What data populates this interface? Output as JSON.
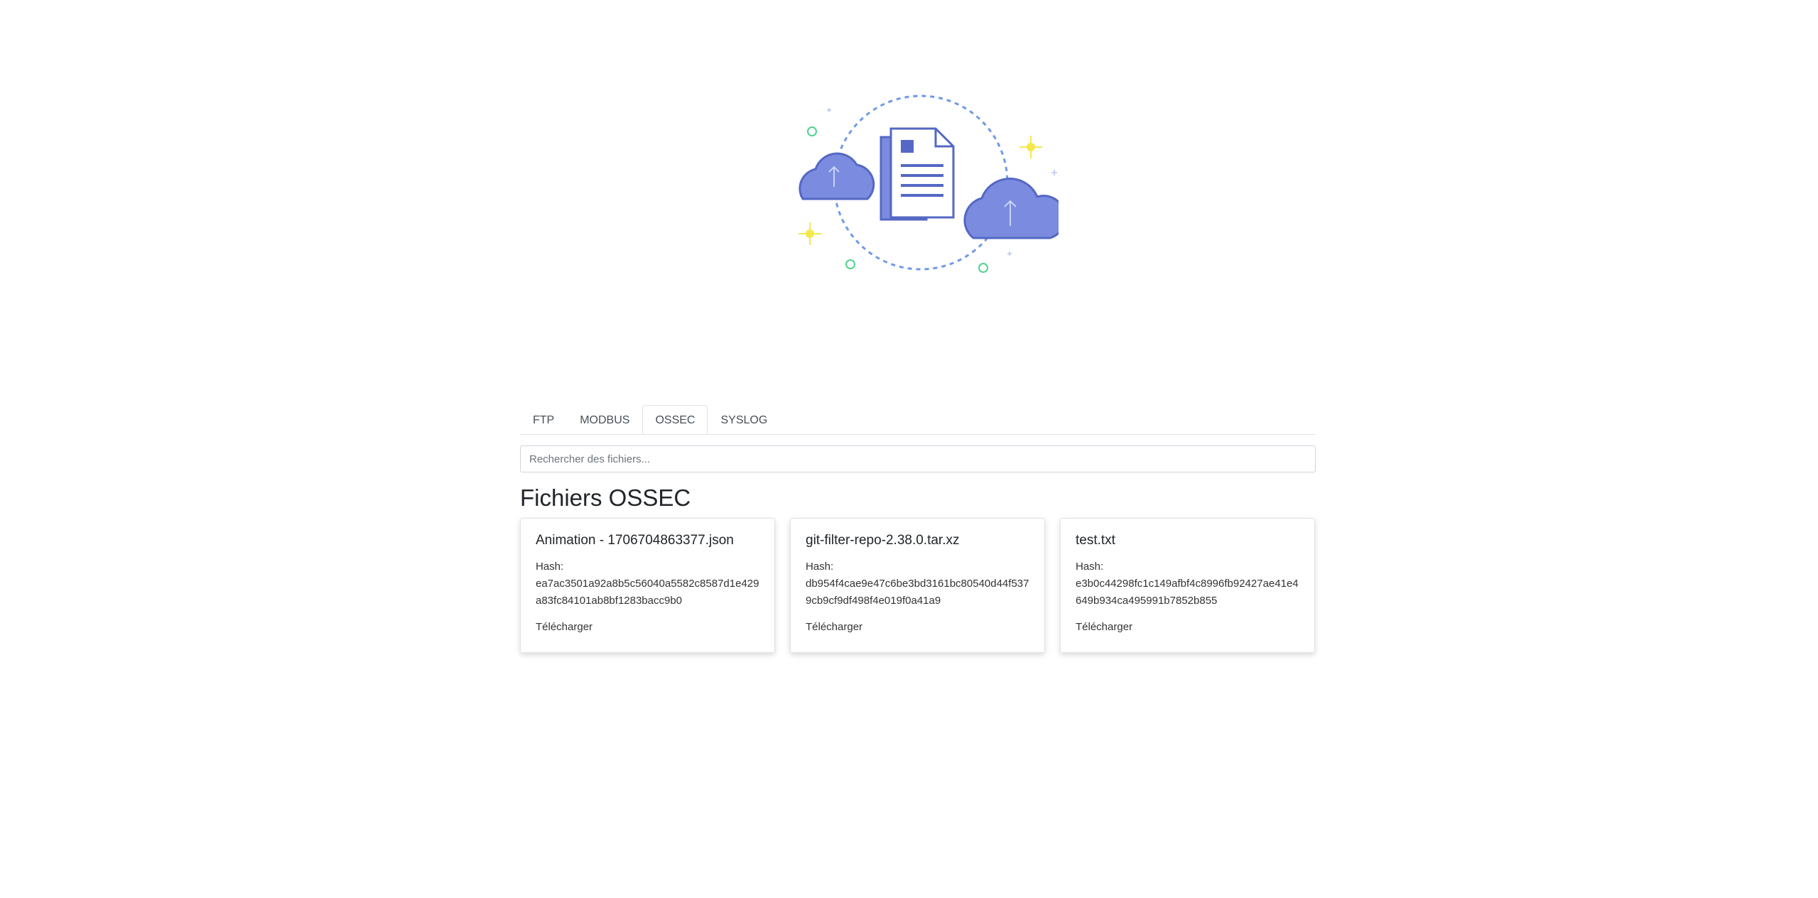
{
  "hero": {
    "illustration": "cloud-upload-document-icon",
    "colors": {
      "primary": "#7b8be0",
      "stroke": "#5468c4",
      "dashed_circle": "#6f9ae6",
      "sparkle": "#f5e84a",
      "dots_green": "#4fd38f"
    }
  },
  "tabs": [
    {
      "label": "FTP",
      "active": false
    },
    {
      "label": "MODBUS",
      "active": false
    },
    {
      "label": "OSSEC",
      "active": true
    },
    {
      "label": "SYSLOG",
      "active": false
    }
  ],
  "search": {
    "placeholder": "Rechercher des fichiers...",
    "value": ""
  },
  "section_title": "Fichiers OSSEC",
  "files": [
    {
      "name": "Animation - 1706704863377.json",
      "hash_label": "Hash:",
      "hash": "ea7ac3501a92a8b5c56040a5582c8587d1e429a83fc84101ab8bf1283bacc9b0",
      "download_label": "Télécharger"
    },
    {
      "name": "git-filter-repo-2.38.0.tar.xz",
      "hash_label": "Hash:",
      "hash": "db954f4cae9e47c6be3bd3161bc80540d44f5379cb9cf9df498f4e019f0a41a9",
      "download_label": "Télécharger"
    },
    {
      "name": "test.txt",
      "hash_label": "Hash:",
      "hash": "e3b0c44298fc1c149afbf4c8996fb92427ae41e4649b934ca495991b7852b855",
      "download_label": "Télécharger"
    }
  ]
}
